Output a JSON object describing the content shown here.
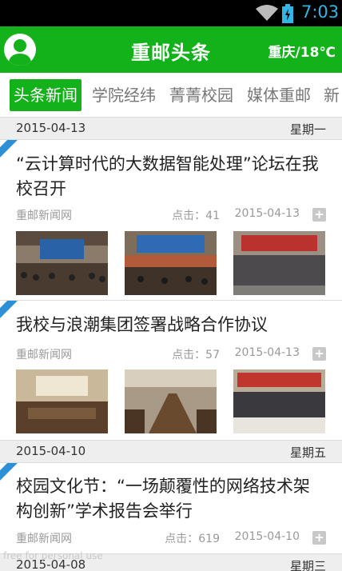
{
  "status_bar": {
    "time": "7:03"
  },
  "app_bar": {
    "title": "重邮头条",
    "weather": "重庆/18℃",
    "avatar_icon": "user-avatar-icon"
  },
  "tabs": [
    "头条新闻",
    "学院经纬",
    "菁菁校园",
    "媒体重邮",
    "新"
  ],
  "active_tab": 0,
  "date_headers": [
    {
      "date": "2015-04-13",
      "weekday": "星期一"
    },
    {
      "date": "2015-04-10",
      "weekday": "星期五"
    },
    {
      "date": "2015-04-08",
      "weekday": "星期三"
    }
  ],
  "articles": [
    {
      "title": "“云计算时代的大数据智能处理”论坛在我校召开",
      "source": "重邮新闻网",
      "clicks": "点击：41",
      "date": "2015-04-13",
      "thumbnails": [
        "conference-hall-photo",
        "forum-stage-photo",
        "group-photo"
      ]
    },
    {
      "title": "我校与浪潮集团签署战略合作协议",
      "source": "重邮新闻网",
      "clicks": "点击：57",
      "date": "2015-04-13",
      "thumbnails": [
        "meeting-room-photo",
        "conference-table-photo",
        "signing-ceremony-photo"
      ]
    },
    {
      "title": "校园文化节：“一场颠覆性的网络技术架构创新”学术报告会举行",
      "source": "重邮新闻网",
      "clicks": "点击：619",
      "date": "2015-04-10"
    }
  ],
  "watermark": "free for personal use"
}
